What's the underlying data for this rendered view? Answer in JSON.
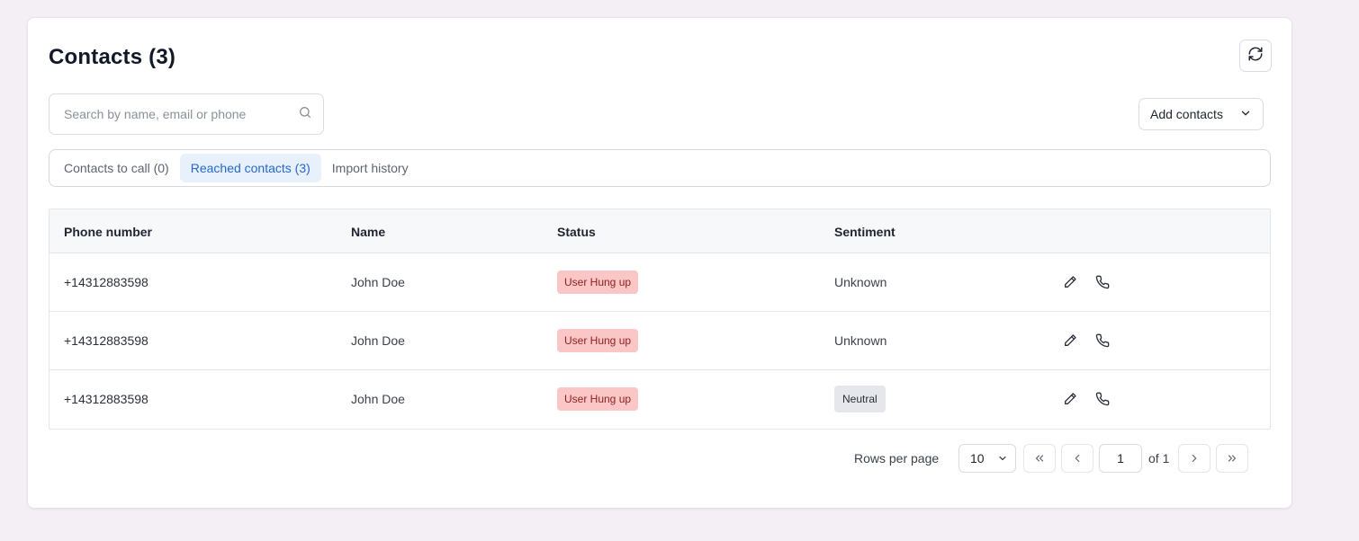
{
  "header": {
    "title": "Contacts (3)"
  },
  "search": {
    "placeholder": "Search by name, email or phone"
  },
  "actions": {
    "add_contacts_label": "Add contacts"
  },
  "tabs": [
    {
      "label": "Contacts to call (0)",
      "active": false
    },
    {
      "label": "Reached contacts (3)",
      "active": true
    },
    {
      "label": "Import history",
      "active": false
    }
  ],
  "table": {
    "columns": [
      "Phone number",
      "Name",
      "Status",
      "Sentiment"
    ],
    "rows": [
      {
        "phone": "+14312883598",
        "name": "John Doe",
        "status": "User Hung up",
        "sentiment": "Unknown",
        "sentiment_badge": false
      },
      {
        "phone": "+14312883598",
        "name": "John Doe",
        "status": "User Hung up",
        "sentiment": "Unknown",
        "sentiment_badge": false
      },
      {
        "phone": "+14312883598",
        "name": "John Doe",
        "status": "User Hung up",
        "sentiment": "Neutral",
        "sentiment_badge": true
      }
    ]
  },
  "pagination": {
    "rows_per_page_label": "Rows per page",
    "rows_per_page_value": "10",
    "current_page": "1",
    "of_label": "of 1"
  },
  "colors": {
    "background": "#f4eff4",
    "active_tab_bg": "#e8f1fb",
    "active_tab_text": "#2468c8",
    "status_badge_bg": "#fbc6c6",
    "status_badge_text": "#8c1f1f",
    "neutral_badge_bg": "#e6e7ea"
  }
}
